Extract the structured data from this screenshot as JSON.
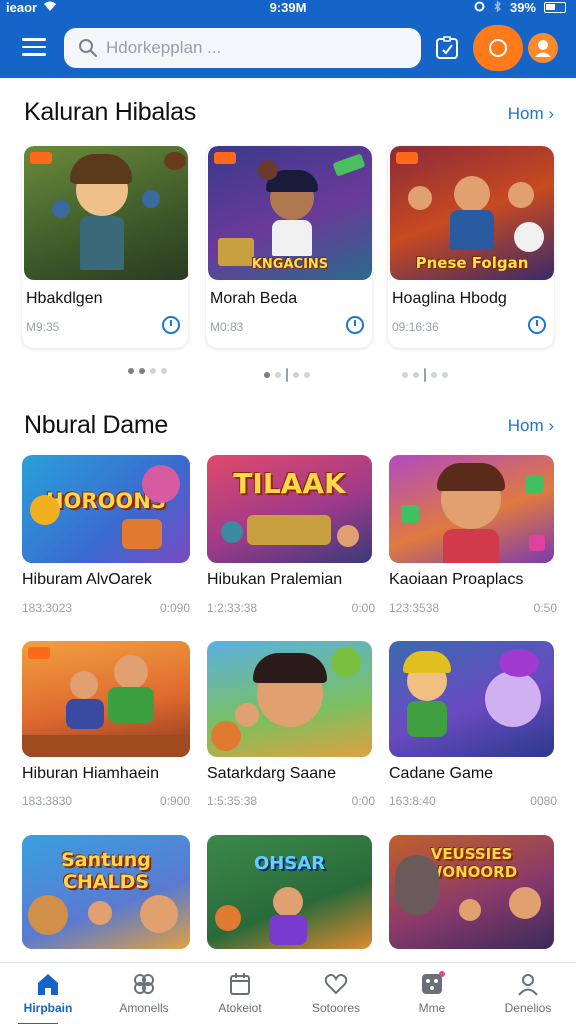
{
  "status_bar": {
    "carrier": "ieaor",
    "time": "9:39M",
    "battery": "39%"
  },
  "header": {
    "search_placeholder": "Hdorkepplan ...",
    "colors": {
      "bar": "#1565c8",
      "accent": "#ff7a1a"
    }
  },
  "featured": {
    "title": "Kaluran Hibalas",
    "more": "Hom ›",
    "cards": [
      {
        "name": "Hbakdlgen",
        "meta": "M9:35",
        "icon": "clock-icon"
      },
      {
        "name": "Morah Beda",
        "meta": "M0:83",
        "art_text": "KNGACINS",
        "icon": "clock-icon"
      },
      {
        "name": "Hoaglina Hbodg",
        "meta": "09:16:36",
        "art_text": "Pnese Folgan",
        "icon": "clock-icon"
      }
    ]
  },
  "games": {
    "title": "Nbural Dame",
    "more": "Hom ›",
    "items": [
      {
        "name": "Hiburam AlvOarek",
        "meta": "183:3023",
        "time": "0:090",
        "art_text": "HOROONS"
      },
      {
        "name": "Hibukan Pralemian",
        "meta": "1:2:33:38",
        "time": "0:00",
        "art_text": "TILAAK"
      },
      {
        "name": "Kaoiaan Proaplacs",
        "meta": "123:3538",
        "time": "0:50",
        "art_text": ""
      },
      {
        "name": "Hiburan Hiamhaein",
        "meta": "183:3830",
        "time": "0:900",
        "art_text": ""
      },
      {
        "name": "Satarkdarg Saane",
        "meta": "1:5:35:38",
        "time": "0:00",
        "art_text": ""
      },
      {
        "name": "Cadane Game",
        "meta": "163:8:40",
        "time": "0080",
        "art_text": ""
      },
      {
        "name": "",
        "meta": "",
        "time": "",
        "art_text": "Santung CHALDS"
      },
      {
        "name": "",
        "meta": "",
        "time": "",
        "art_text": "OHSAR"
      },
      {
        "name": "",
        "meta": "",
        "time": "",
        "art_text": "VEUSSIES WONOORD"
      }
    ]
  },
  "bottom_nav": [
    {
      "label": "Hirpbain",
      "icon": "home-icon",
      "active": true
    },
    {
      "label": "Amonells",
      "icon": "gamepad-icon",
      "active": false
    },
    {
      "label": "Atokeiot",
      "icon": "calendar-icon",
      "active": false
    },
    {
      "label": "Sotoores",
      "icon": "heart-icon",
      "active": false
    },
    {
      "label": "Mme",
      "icon": "controller-icon",
      "active": false
    },
    {
      "label": "Denelios",
      "icon": "profile-icon",
      "active": false
    }
  ]
}
